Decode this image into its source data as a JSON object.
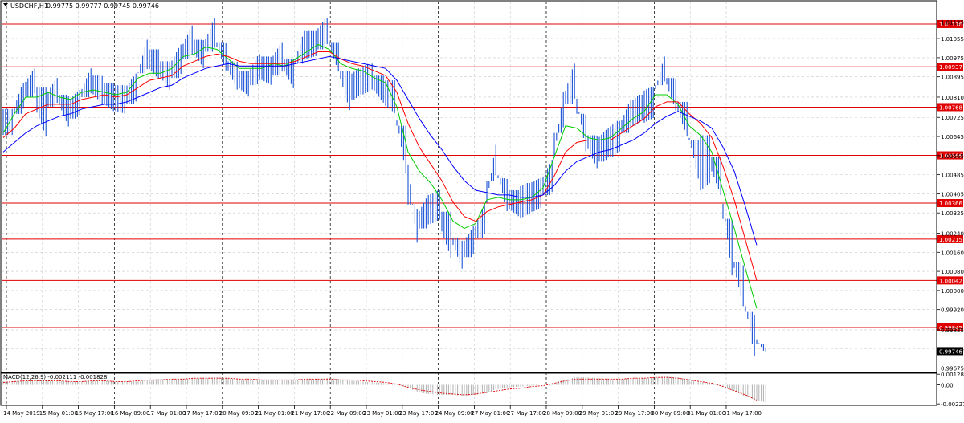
{
  "chart_data": {
    "type": "line",
    "symbol": "USDCHF,H1",
    "ohlc_readout": "0.99775 0.99777 0.99745 0.99746",
    "y_ticks": [
      "1.01125",
      "1.01055",
      "1.00975",
      "1.00895",
      "1.00810",
      "1.00725",
      "1.00645",
      "1.00565",
      "1.00485",
      "1.00405",
      "1.00325",
      "1.00240",
      "1.00160",
      "1.00080",
      "1.00000",
      "0.99920",
      "0.99835",
      "0.99755",
      "0.99675"
    ],
    "y_range": [
      0.9966,
      1.0121
    ],
    "x_ticks": [
      "14 May 2019",
      "15 May 01:00",
      "15 May 17:00",
      "16 May 09:00",
      "17 May 01:00",
      "17 May 17:00",
      "20 May 09:00",
      "21 May 01:00",
      "21 May 17:00",
      "22 May 09:00",
      "23 May 01:00",
      "23 May 17:00",
      "24 May 09:00",
      "27 May 01:00",
      "27 May 17:00",
      "28 May 09:00",
      "29 May 01:00",
      "29 May 17:00",
      "30 May 09:00",
      "31 May 01:00",
      "31 May 17:00"
    ],
    "horizontal_levels": [
      {
        "label": "1.01116",
        "value": 1.01116
      },
      {
        "label": "1.00937",
        "value": 1.00937
      },
      {
        "label": "1.00768",
        "value": 1.00768
      },
      {
        "label": "1.00566",
        "value": 1.00566
      },
      {
        "label": "1.00366",
        "value": 1.00366
      },
      {
        "label": "1.00215",
        "value": 1.00215
      },
      {
        "label": "1.00042",
        "value": 1.00042
      },
      {
        "label": "0.99845",
        "value": 0.99845
      }
    ],
    "current_price_label": "0.99746",
    "grid": true,
    "price_bars": {
      "x": [
        0,
        14,
        28,
        42,
        56,
        70,
        84,
        98,
        112,
        126,
        140,
        154,
        168,
        182,
        196,
        210,
        224,
        238,
        252,
        266,
        280,
        294,
        308,
        322,
        336,
        350,
        364,
        378,
        392,
        406,
        420,
        434,
        448,
        462,
        476,
        490,
        504,
        518,
        532,
        546,
        560,
        574,
        588,
        602,
        616,
        630,
        644,
        658,
        672,
        686,
        700,
        714,
        728,
        742,
        756,
        770,
        784,
        798,
        812,
        826,
        840,
        854,
        868,
        882,
        896,
        910,
        924,
        938
      ],
      "close": [
        1.0071,
        1.0082,
        1.0088,
        1.0078,
        1.0084,
        1.0075,
        1.0079,
        1.0088,
        1.0084,
        1.0081,
        1.008,
        1.0085,
        1.0099,
        1.0095,
        1.009,
        1.0097,
        1.0105,
        1.0099,
        1.0108,
        1.0098,
        1.009,
        1.0087,
        1.0094,
        1.0092,
        1.0098,
        1.0091,
        1.0103,
        1.0104,
        1.0109,
        1.0098,
        1.0085,
        1.0088,
        1.009,
        1.0085,
        1.0082,
        1.006,
        1.0027,
        1.0034,
        1.0036,
        1.0025,
        1.0015,
        1.0021,
        1.003,
        1.0055,
        1.004,
        1.0037,
        1.0039,
        1.0041,
        1.0048,
        1.0076,
        1.0088,
        1.0066,
        1.0058,
        1.0062,
        1.0065,
        1.0074,
        1.0077,
        1.0079,
        1.0093,
        1.0082,
        1.0072,
        1.0055,
        1.0058,
        1.0048,
        1.0018,
        1.0002,
        0.9981,
        0.99746
      ],
      "high": [
        1.0076,
        1.0087,
        1.0093,
        1.0085,
        1.0089,
        1.0082,
        1.0084,
        1.0093,
        1.009,
        1.0087,
        1.0086,
        1.0091,
        1.0105,
        1.0101,
        1.0096,
        1.0103,
        1.0111,
        1.0105,
        1.0114,
        1.0104,
        1.0096,
        1.0092,
        1.0099,
        1.0098,
        1.0104,
        1.0097,
        1.0109,
        1.0109,
        1.0114,
        1.0104,
        1.0092,
        1.0093,
        1.0095,
        1.009,
        1.0088,
        1.0069,
        1.0036,
        1.004,
        1.0042,
        1.0033,
        1.0022,
        1.0027,
        1.0036,
        1.0061,
        1.0047,
        1.0042,
        1.0045,
        1.0047,
        1.0055,
        1.0083,
        1.0095,
        1.0074,
        1.0065,
        1.0068,
        1.0071,
        1.008,
        1.0082,
        1.0085,
        1.0098,
        1.0089,
        1.0079,
        1.0063,
        1.0065,
        1.0056,
        1.003,
        1.0012,
        0.9991,
        0.99777
      ],
      "low": [
        1.0063,
        1.0074,
        1.0081,
        1.0055,
        1.0077,
        1.0068,
        1.0072,
        1.0081,
        1.0077,
        1.0074,
        1.0073,
        1.0078,
        1.0091,
        1.0087,
        1.0083,
        1.0089,
        1.0097,
        1.0092,
        1.01,
        1.0091,
        1.0083,
        1.008,
        1.0086,
        1.0085,
        1.009,
        1.0083,
        1.0095,
        1.0096,
        1.0101,
        1.009,
        1.0071,
        1.008,
        1.0082,
        1.0076,
        1.0071,
        1.0045,
        1.002,
        1.0026,
        1.0028,
        1.0008,
        1.0009,
        1.0014,
        1.0022,
        1.0046,
        1.0032,
        1.0029,
        1.003,
        1.0033,
        1.004,
        1.0066,
        1.0078,
        1.0057,
        1.005,
        1.0054,
        1.0056,
        1.0066,
        1.0069,
        1.007,
        1.0086,
        1.0074,
        1.0063,
        1.0045,
        1.0036,
        1.0038,
        1.0004,
        0.9993,
        0.9972,
        0.99745
      ]
    },
    "series": [
      {
        "name": "",
        "color": "#00cc00",
        "x": [
          0,
          14,
          28,
          42,
          56,
          70,
          84,
          98,
          112,
          126,
          140,
          154,
          168,
          182,
          196,
          210,
          224,
          238,
          252,
          266,
          280,
          294,
          308,
          322,
          336,
          350,
          364,
          378,
          392,
          406,
          420,
          434,
          448,
          462,
          476,
          490,
          504,
          518,
          532,
          546,
          560,
          574,
          588,
          602,
          616,
          630,
          644,
          658,
          672,
          686,
          700,
          714,
          728,
          742,
          756,
          770,
          784,
          798,
          812,
          826,
          840,
          854,
          868,
          882,
          896,
          910,
          924,
          938
        ],
        "values": [
          1.0066,
          1.0074,
          1.0081,
          1.0081,
          1.0083,
          1.0081,
          1.008,
          1.0083,
          1.0084,
          1.0083,
          1.0082,
          1.0083,
          1.0089,
          1.0091,
          1.0091,
          1.0093,
          1.0098,
          1.0099,
          1.0102,
          1.0101,
          1.0097,
          1.0093,
          1.0093,
          1.0093,
          1.0095,
          1.0094,
          1.0097,
          1.01,
          1.0103,
          1.0101,
          1.0095,
          1.0093,
          1.0092,
          1.0089,
          1.0087,
          1.0077,
          1.0058,
          1.005,
          1.0045,
          1.0038,
          1.0029,
          1.0026,
          1.0028,
          1.0038,
          1.0039,
          1.0038,
          1.0038,
          1.0039,
          1.0043,
          1.0056,
          1.0069,
          1.0068,
          1.0064,
          1.0063,
          1.0064,
          1.0068,
          1.0072,
          1.0075,
          1.0082,
          1.0082,
          1.0078,
          1.0069,
          1.0065,
          1.0058,
          1.0042,
          1.0026,
          1.0009,
          0.99925
        ]
      },
      {
        "name": "",
        "color": "#ff0000",
        "x": [
          0,
          14,
          28,
          42,
          56,
          70,
          84,
          98,
          112,
          126,
          140,
          154,
          168,
          182,
          196,
          210,
          224,
          238,
          252,
          266,
          280,
          294,
          308,
          322,
          336,
          350,
          364,
          378,
          392,
          406,
          420,
          434,
          448,
          462,
          476,
          490,
          504,
          518,
          532,
          546,
          560,
          574,
          588,
          602,
          616,
          630,
          644,
          658,
          672,
          686,
          700,
          714,
          728,
          742,
          756,
          770,
          784,
          798,
          812,
          826,
          840,
          854,
          868,
          882,
          896,
          910,
          924,
          938
        ],
        "values": [
          1.0064,
          1.0068,
          1.0074,
          1.0076,
          1.0078,
          1.0078,
          1.0078,
          1.008,
          1.0081,
          1.0082,
          1.0081,
          1.0082,
          1.0085,
          1.0088,
          1.0089,
          1.009,
          1.0094,
          1.0096,
          1.0098,
          1.0099,
          1.0098,
          1.0096,
          1.0095,
          1.0095,
          1.0095,
          1.0095,
          1.0096,
          1.0098,
          1.01,
          1.01,
          1.0097,
          1.0095,
          1.0094,
          1.0092,
          1.009,
          1.0083,
          1.007,
          1.006,
          1.0053,
          1.0046,
          1.0037,
          1.0031,
          1.0029,
          1.0033,
          1.0035,
          1.0036,
          1.0037,
          1.0038,
          1.004,
          1.0048,
          1.0058,
          1.0062,
          1.0063,
          1.0063,
          1.0063,
          1.0066,
          1.0069,
          1.0072,
          1.0077,
          1.0079,
          1.0079,
          1.0074,
          1.007,
          1.0064,
          1.0052,
          1.0038,
          1.0021,
          1.00042
        ]
      },
      {
        "name": "",
        "color": "#0000ff",
        "x": [
          0,
          14,
          28,
          42,
          56,
          70,
          84,
          98,
          112,
          126,
          140,
          154,
          168,
          182,
          196,
          210,
          224,
          238,
          252,
          266,
          280,
          294,
          308,
          322,
          336,
          350,
          364,
          378,
          392,
          406,
          420,
          434,
          448,
          462,
          476,
          490,
          504,
          518,
          532,
          546,
          560,
          574,
          588,
          602,
          616,
          630,
          644,
          658,
          672,
          686,
          700,
          714,
          728,
          742,
          756,
          770,
          784,
          798,
          812,
          826,
          840,
          854,
          868,
          882,
          896,
          910,
          924,
          938
        ],
        "values": [
          1.0058,
          1.0062,
          1.0066,
          1.0069,
          1.0071,
          1.0073,
          1.0074,
          1.0076,
          1.0077,
          1.0078,
          1.0078,
          1.0079,
          1.0081,
          1.0083,
          1.0085,
          1.0086,
          1.0089,
          1.0091,
          1.0093,
          1.0094,
          1.0095,
          1.0094,
          1.0094,
          1.0094,
          1.0094,
          1.0094,
          1.0095,
          1.0096,
          1.0097,
          1.0098,
          1.0097,
          1.0096,
          1.0095,
          1.0094,
          1.0093,
          1.0088,
          1.008,
          1.0072,
          1.0065,
          1.0059,
          1.0052,
          1.0046,
          1.0042,
          1.0041,
          1.004,
          1.004,
          1.0039,
          1.0039,
          1.004,
          1.0044,
          1.005,
          1.0054,
          1.0056,
          1.0058,
          1.0059,
          1.0061,
          1.0063,
          1.0066,
          1.007,
          1.0073,
          1.0075,
          1.0073,
          1.0071,
          1.0068,
          1.006,
          1.005,
          1.0035,
          1.0019
        ]
      }
    ],
    "macd": {
      "label": "MACD(12,26,9) -0.002111 -0.001828",
      "y_ticks": [
        "0.001284",
        "0.00",
        "-0.002273"
      ],
      "y_range": [
        -0.00245,
        0.0014
      ],
      "x": [
        0,
        14,
        28,
        42,
        56,
        70,
        84,
        98,
        112,
        126,
        140,
        154,
        168,
        182,
        196,
        210,
        224,
        238,
        252,
        266,
        280,
        294,
        308,
        322,
        336,
        350,
        364,
        378,
        392,
        406,
        420,
        434,
        448,
        462,
        476,
        490,
        504,
        518,
        532,
        546,
        560,
        574,
        588,
        602,
        616,
        630,
        644,
        658,
        672,
        686,
        700,
        714,
        728,
        742,
        756,
        770,
        784,
        798,
        812,
        826,
        840,
        854,
        868,
        882,
        896,
        910,
        924,
        938
      ],
      "histogram": [
        0.0004,
        0.0005,
        0.0006,
        0.0005,
        0.0005,
        0.0004,
        0.0004,
        0.0005,
        0.0005,
        0.0004,
        0.0004,
        0.0004,
        0.0006,
        0.0007,
        0.0007,
        0.0007,
        0.0008,
        0.0008,
        0.0009,
        0.0008,
        0.0007,
        0.0006,
        0.0006,
        0.0006,
        0.0006,
        0.0006,
        0.0007,
        0.0007,
        0.0008,
        0.0007,
        0.0005,
        0.0004,
        0.0003,
        0.0002,
        0.0001,
        -0.0003,
        -0.0009,
        -0.0011,
        -0.0012,
        -0.0012,
        -0.0013,
        -0.0012,
        -0.001,
        -0.0005,
        -0.0003,
        -0.0002,
        -0.0001,
        0.0,
        0.0002,
        0.0006,
        0.0009,
        0.0009,
        0.0008,
        0.0007,
        0.0007,
        0.0008,
        0.0008,
        0.0009,
        0.001,
        0.0009,
        0.0007,
        0.0004,
        0.0002,
        -0.0001,
        -0.0007,
        -0.0013,
        -0.0018,
        -0.002111
      ],
      "signal": [
        0.0003,
        0.0004,
        0.0005,
        0.0005,
        0.0005,
        0.0005,
        0.0004,
        0.0004,
        0.0005,
        0.0005,
        0.0004,
        0.0004,
        0.0005,
        0.0006,
        0.0006,
        0.0007,
        0.0007,
        0.0008,
        0.0008,
        0.0008,
        0.0008,
        0.0007,
        0.0007,
        0.0006,
        0.0006,
        0.0006,
        0.0006,
        0.0007,
        0.0007,
        0.0007,
        0.0006,
        0.0006,
        0.0005,
        0.0004,
        0.0003,
        0.0001,
        -0.0003,
        -0.0006,
        -0.0008,
        -0.001,
        -0.0011,
        -0.0012,
        -0.0011,
        -0.0009,
        -0.0007,
        -0.0005,
        -0.0004,
        -0.0002,
        -0.0001,
        0.0002,
        0.0005,
        0.0007,
        0.0007,
        0.0007,
        0.0007,
        0.0007,
        0.0008,
        0.0008,
        0.0009,
        0.0009,
        0.0008,
        0.0006,
        0.0004,
        0.0002,
        -0.0002,
        -0.0007,
        -0.0012,
        -0.001828
      ]
    }
  }
}
